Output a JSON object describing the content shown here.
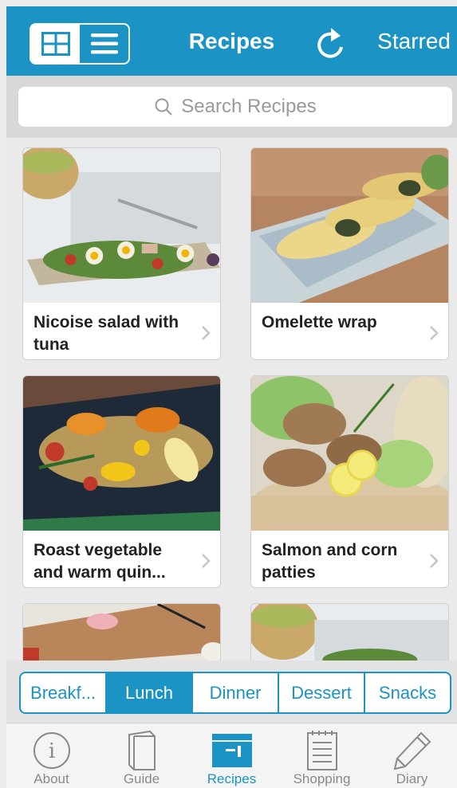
{
  "header": {
    "title": "Recipes",
    "starred_label": "Starred",
    "brand_color": "#1b93c4"
  },
  "search": {
    "placeholder": "Search Recipes"
  },
  "recipes": [
    {
      "name": "Nicoise salad with tuna"
    },
    {
      "name": "Omelette wrap"
    },
    {
      "name": "Roast vegetable and warm quin..."
    },
    {
      "name": "Salmon and corn patties"
    }
  ],
  "categories": {
    "items": [
      "Breakf...",
      "Lunch",
      "Dinner",
      "Dessert",
      "Snacks"
    ],
    "selected": "Lunch"
  },
  "tabbar": {
    "items": [
      {
        "label": "About",
        "icon": "info-icon"
      },
      {
        "label": "Guide",
        "icon": "book-icon"
      },
      {
        "label": "Recipes",
        "icon": "recipe-box-icon"
      },
      {
        "label": "Shopping",
        "icon": "notepad-icon"
      },
      {
        "label": "Diary",
        "icon": "pencil-icon"
      }
    ],
    "selected": "Recipes"
  }
}
